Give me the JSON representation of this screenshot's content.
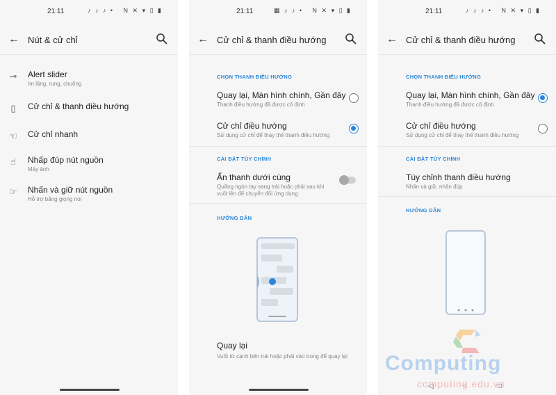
{
  "status": {
    "time": "21:11"
  },
  "p1": {
    "title": "Nút & cử chỉ",
    "items": [
      {
        "title": "Alert slider",
        "sub": "Im lặng, rung, chuông",
        "icon": "alert-slider-icon"
      },
      {
        "title": "Cử chỉ & thanh điều hướng",
        "sub": "",
        "icon": "phone-icon"
      },
      {
        "title": "Cử chỉ nhanh",
        "sub": "",
        "icon": "gesture-hand-icon"
      },
      {
        "title": "Nhấp đúp nút nguồn",
        "sub": "Máy ảnh",
        "icon": "double-tap-icon"
      },
      {
        "title": "Nhấn và giữ nút nguồn",
        "sub": "Hỗ trợ bằng giọng nói",
        "icon": "press-hold-icon"
      }
    ]
  },
  "p2": {
    "title": "Cử chỉ & thanh điều hướng",
    "section_nav": "CHỌN THANH ĐIỀU HƯỚNG",
    "option1": {
      "title": "Quay lại, Màn hình chính, Gần đây",
      "sub": "Thanh điều hướng đã được cố định",
      "selected": false
    },
    "option2": {
      "title": "Cử chỉ điều hướng",
      "sub": "Sử dụng cử chỉ để thay thế thanh điều hướng",
      "selected": true
    },
    "section_custom": "CÀI ĐẶT TÙY CHỈNH",
    "hide_bar": {
      "title": "Ẩn thanh dưới cùng",
      "sub1": "Quãng ngón tay sang trái hoặc phải sau khi",
      "sub2": "vuốt lên để chuyển đổi ứng dụng",
      "enabled": false
    },
    "section_guide": "HƯỚNG DẪN",
    "guide": {
      "title": "Quay lại",
      "sub": "Vuốt từ cạnh bên trái hoặc phải vào trong để quay lại"
    }
  },
  "p3": {
    "title": "Cử chỉ & thanh điều hướng",
    "section_nav": "CHỌN THANH ĐIỀU HƯỚNG",
    "option1": {
      "title": "Quay lại, Màn hình chính, Gần đây",
      "sub": "Thanh điều hướng đã được cố định",
      "selected": true
    },
    "option2": {
      "title": "Cử chỉ điều hướng",
      "sub": "Sử dụng cử chỉ để thay thế thanh điều hướng",
      "selected": false
    },
    "section_custom": "CÀI ĐẶT TÙY CHỈNH",
    "customize": {
      "title": "Tùy chỉnh thanh điều hướng",
      "sub": "Nhấn và giữ, nhấn đúp"
    },
    "section_guide": "HƯỚNG DẪN"
  },
  "watermark": {
    "brand": "Computing",
    "domain": "computing.edu.vn"
  },
  "colors": {
    "accent": "#2a86d8",
    "background": "#f6f6f6"
  }
}
